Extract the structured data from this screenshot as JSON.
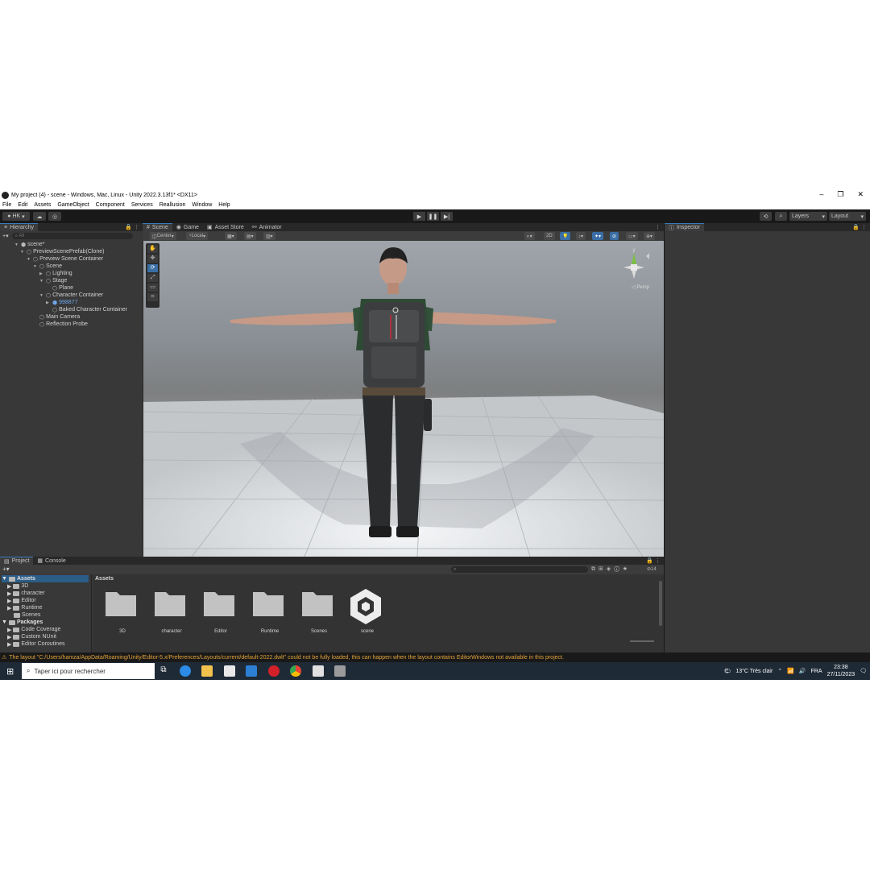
{
  "window": {
    "title": "My project (4) - scene - Windows, Mac, Linux - Unity 2022.3.13f1* <DX11>"
  },
  "menu": [
    "File",
    "Edit",
    "Assets",
    "GameObject",
    "Component",
    "Services",
    "Reallusion",
    "Window",
    "Help"
  ],
  "toolbar": {
    "account": "HK",
    "layers": "Layers",
    "layout": "Layout"
  },
  "hierarchy": {
    "tab": "Hierarchy",
    "search_placeholder": "All",
    "items": [
      {
        "label": "scene*"
      },
      {
        "label": "PreviewScenePrefab(Clone)"
      },
      {
        "label": "Preview Scene Container"
      },
      {
        "label": "Scene"
      },
      {
        "label": "Lighting"
      },
      {
        "label": "Stage"
      },
      {
        "label": "Plane"
      },
      {
        "label": "Character Container"
      },
      {
        "label": "998877"
      },
      {
        "label": "Baked Character Container"
      },
      {
        "label": "Main Camera"
      },
      {
        "label": "Reflection Probe"
      }
    ]
  },
  "scene_tabs": [
    "Scene",
    "Game",
    "Asset Store",
    "Animator"
  ],
  "scene_toolbar": {
    "pivot": "Center",
    "space": "Local",
    "mode_2d": "2D"
  },
  "viewport": {
    "projection": "Persp",
    "gizmo_up": "y"
  },
  "inspector": {
    "tab": "Inspector"
  },
  "project": {
    "tabs": [
      "Project",
      "Console"
    ],
    "count": "14",
    "tree": [
      {
        "label": "Assets"
      },
      {
        "label": "3D"
      },
      {
        "label": "character"
      },
      {
        "label": "Editor"
      },
      {
        "label": "Runtime"
      },
      {
        "label": "Scenes"
      },
      {
        "label": "Packages"
      },
      {
        "label": "Code Coverage"
      },
      {
        "label": "Custom NUnit"
      },
      {
        "label": "Editor Coroutines"
      }
    ],
    "path": "Assets",
    "assets": [
      {
        "label": "3D"
      },
      {
        "label": "character"
      },
      {
        "label": "Editor"
      },
      {
        "label": "Runtime"
      },
      {
        "label": "Scenes"
      },
      {
        "label": "scene"
      }
    ]
  },
  "status": {
    "message": "The layout \"C:/Users/hamza/AppData/Roaming/Unity/Editor-5.x/Preferences/Layouts/current/default-2022.dwlt\" could not be fully loaded, this can happen when the layout contains EditorWindows not available in this project."
  },
  "taskbar": {
    "search_placeholder": "Taper ici pour rechercher",
    "weather": "13°C  Très clair",
    "language": "FRA",
    "time": "23:38",
    "date": "27/11/2023"
  },
  "colors": {
    "accent": "#3a79bb",
    "warning": "#e2a33a",
    "selected_text": "#6ea6e8"
  }
}
